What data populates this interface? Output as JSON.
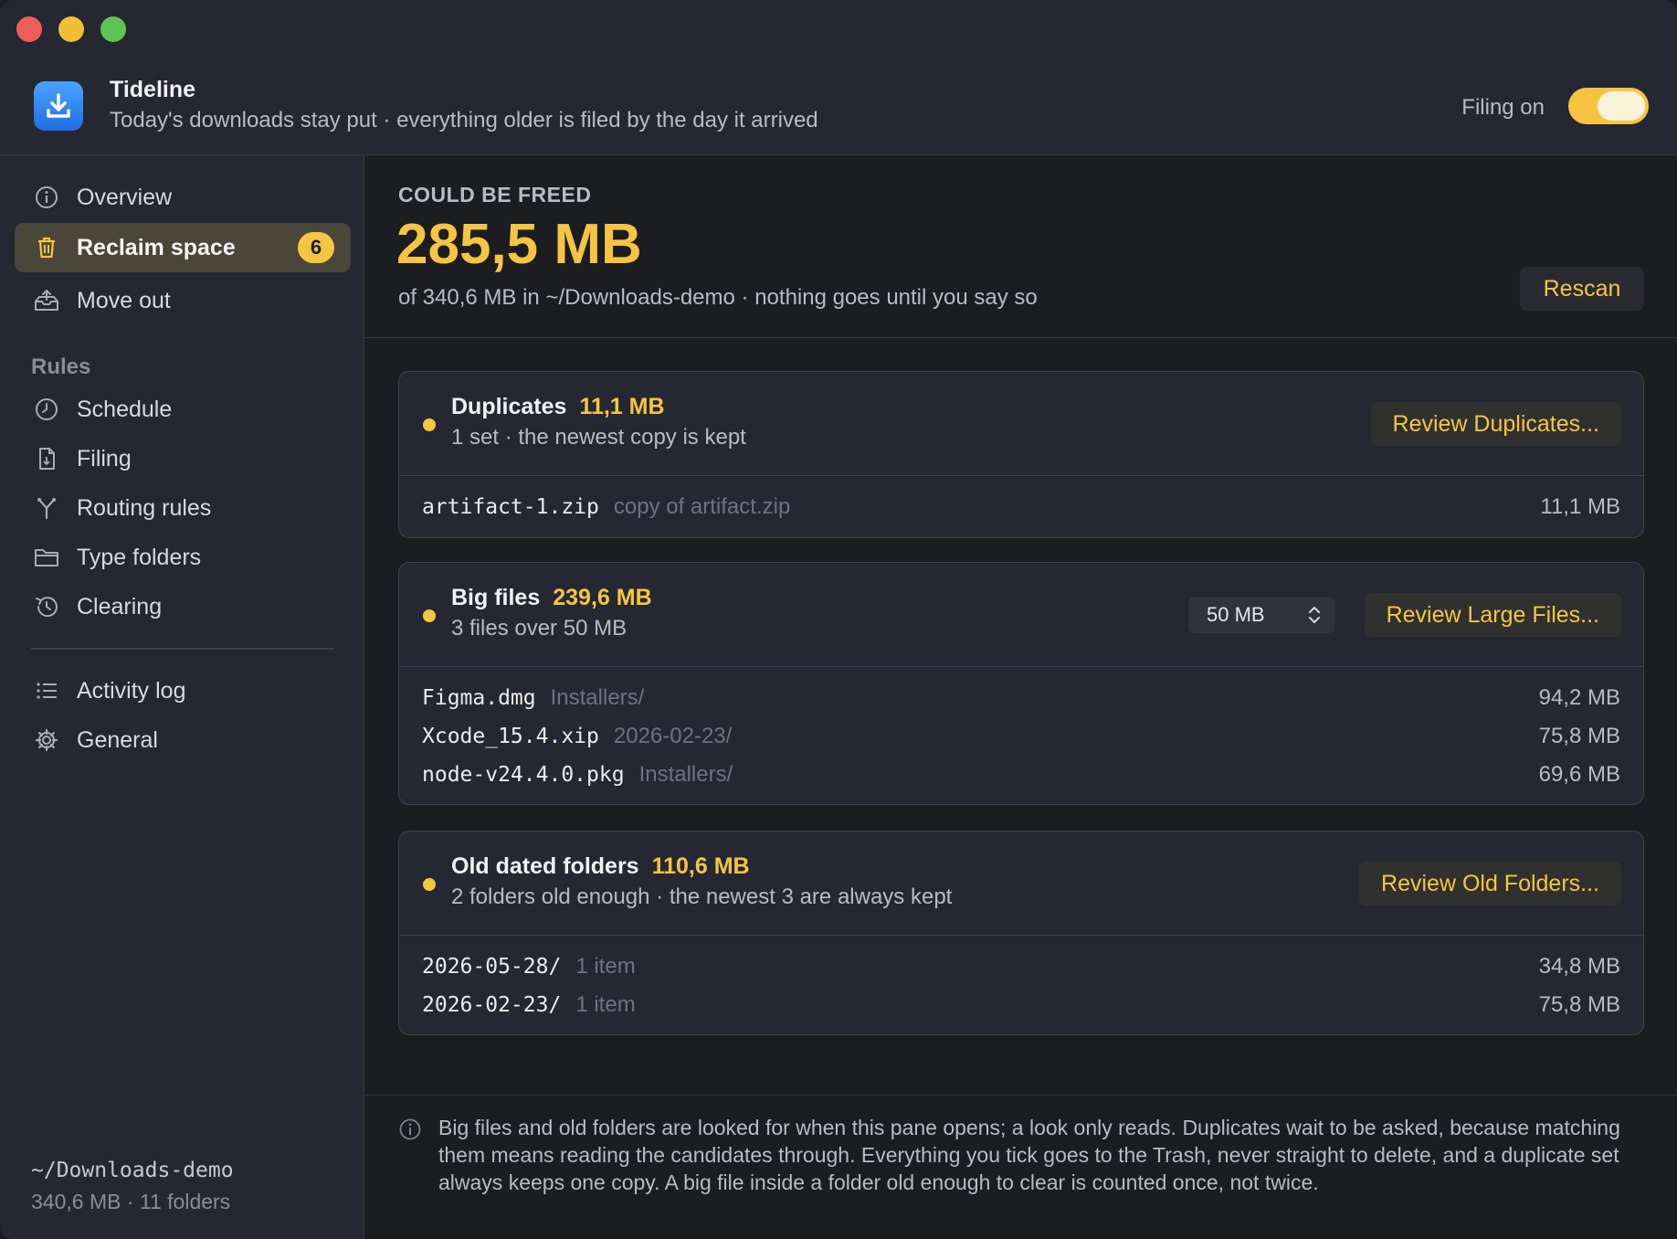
{
  "app": {
    "name": "Tideline",
    "tagline": "Today's downloads stay put · everything older is filed by the day it arrived",
    "filing_label": "Filing on",
    "filing_on": true
  },
  "sidebar": {
    "nav": [
      {
        "label": "Overview",
        "icon": "info-icon"
      },
      {
        "label": "Reclaim space",
        "icon": "trash-icon",
        "badge": "6",
        "active": true
      },
      {
        "label": "Move out",
        "icon": "tray-up-icon"
      }
    ],
    "rules_label": "Rules",
    "rules": [
      {
        "label": "Schedule",
        "icon": "clock-icon"
      },
      {
        "label": "Filing",
        "icon": "document-icon"
      },
      {
        "label": "Routing rules",
        "icon": "fork-icon"
      },
      {
        "label": "Type folders",
        "icon": "folder-icon"
      },
      {
        "label": "Clearing",
        "icon": "history-icon"
      }
    ],
    "extra": [
      {
        "label": "Activity log",
        "icon": "list-icon"
      },
      {
        "label": "General",
        "icon": "gear-icon"
      }
    ],
    "path": "~/Downloads-demo",
    "stats": "340,6 MB · 11 folders"
  },
  "summary": {
    "kicker": "COULD BE FREED",
    "amount": "285,5 MB",
    "subtitle": "of 340,6 MB in ~/Downloads-demo · nothing goes until you say so",
    "rescan_label": "Rescan"
  },
  "cards": {
    "duplicates": {
      "title": "Duplicates",
      "size": "11,1 MB",
      "subtitle": "1 set · the newest copy is kept",
      "button": "Review Duplicates...",
      "rows": [
        {
          "name": "artifact-1.zip",
          "note": "copy of artifact.zip",
          "size": "11,1 MB"
        }
      ]
    },
    "big_files": {
      "title": "Big files",
      "size": "239,6 MB",
      "subtitle": "3 files over 50 MB",
      "threshold": "50 MB",
      "button": "Review Large Files...",
      "rows": [
        {
          "name": "Figma.dmg",
          "note": "Installers/",
          "size": "94,2 MB"
        },
        {
          "name": "Xcode_15.4.xip",
          "note": "2026-02-23/",
          "size": "75,8 MB"
        },
        {
          "name": "node-v24.4.0.pkg",
          "note": "Installers/",
          "size": "69,6 MB"
        }
      ]
    },
    "old_folders": {
      "title": "Old dated folders",
      "size": "110,6 MB",
      "subtitle": "2 folders old enough · the newest 3 are always kept",
      "button": "Review Old Folders...",
      "rows": [
        {
          "name": "2026-05-28/",
          "note": "1 item",
          "size": "34,8 MB"
        },
        {
          "name": "2026-02-23/",
          "note": "1 item",
          "size": "75,8 MB"
        }
      ]
    }
  },
  "footer": {
    "text": "Big files and old folders are looked for when this pane opens; a look only reads. Duplicates wait to be asked, because matching them means reading the candidates through. Everything you tick goes to the Trash, never straight to delete, and a duplicate set always keeps one copy. A big file inside a folder old enough to clear is counted once, not twice."
  },
  "colors": {
    "accent": "#f5c542",
    "window_bg": "#1c1d21",
    "panel_bg": "#252833",
    "icon_blue": "#2f86f5"
  }
}
